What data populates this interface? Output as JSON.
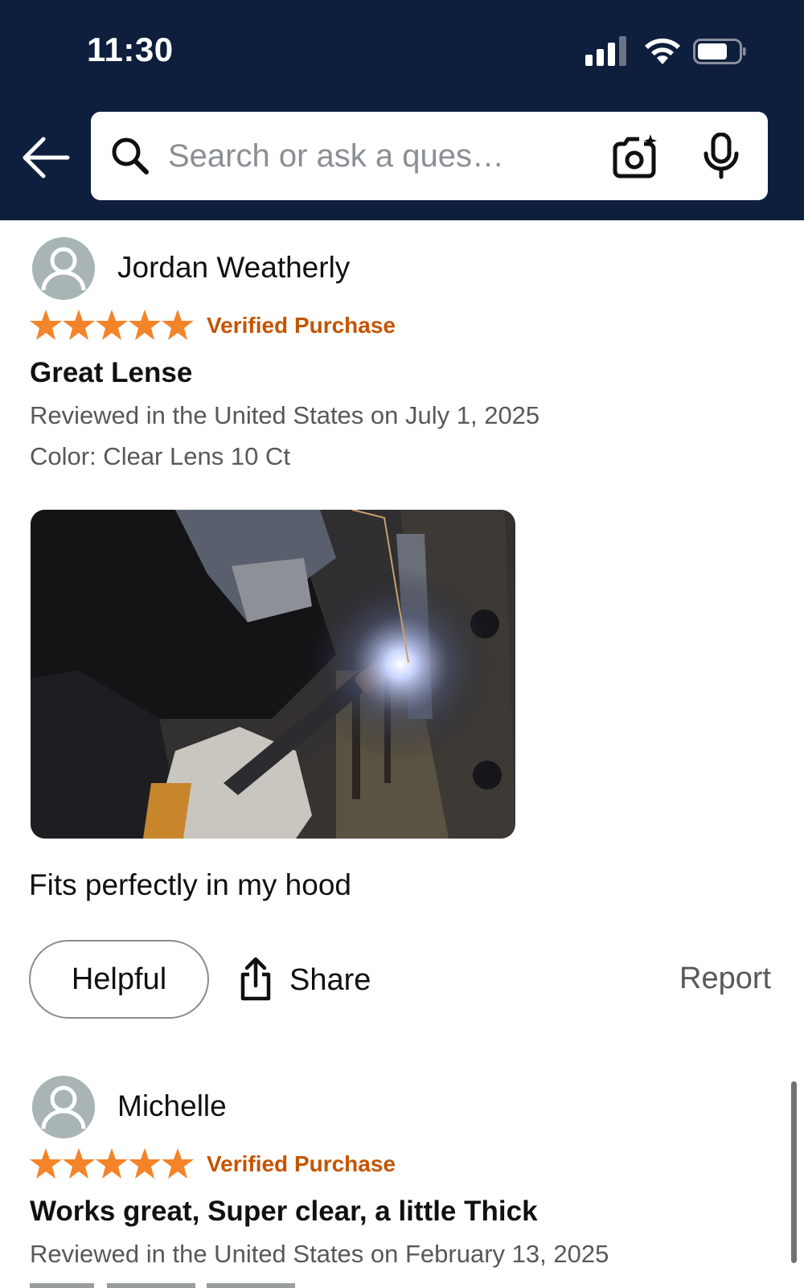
{
  "status_bar": {
    "time": "11:30"
  },
  "header": {
    "search_placeholder": "Search or ask a ques…",
    "icons": [
      "back-arrow-icon",
      "search-icon",
      "camera-icon",
      "microphone-icon"
    ]
  },
  "reviews": [
    {
      "reviewer": "Jordan Weatherly",
      "rating": 5,
      "verified": "Verified Purchase",
      "title": "Great Lense",
      "date_line": "Reviewed in the United States on July 1, 2025",
      "variant": "Color: Clear Lens 10 Ct",
      "body": "Fits perfectly in my hood",
      "actions": {
        "helpful": "Helpful",
        "share": "Share",
        "report": "Report"
      }
    },
    {
      "reviewer": "Michelle",
      "rating": 5,
      "verified": "Verified Purchase",
      "title": "Works great, Super clear, a little Thick",
      "date_line": "Reviewed in the United States on February 13, 2025"
    }
  ],
  "colors": {
    "header_bg": "#0e1f3d",
    "star": "#f3842a",
    "verified": "#c45500",
    "secondary_text": "#565959"
  }
}
